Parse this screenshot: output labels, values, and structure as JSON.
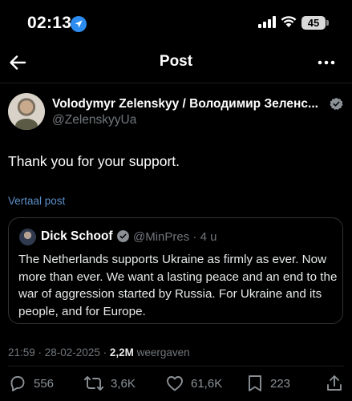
{
  "status_bar": {
    "time": "02:13",
    "battery": "45"
  },
  "header": {
    "title": "Post"
  },
  "post": {
    "author_name": "Volodymyr Zelenskyy / Володимир Зеленс...",
    "author_handle": "@ZelenskyyUa",
    "text": "Thank you for your support.",
    "translate_label": "Vertaal post"
  },
  "quote": {
    "name": "Dick Schoof",
    "handle_time": "@MinPres · 4 u",
    "text": "The Netherlands supports Ukraine as firmly as ever. Now more than ever. We want a lasting peace and an end to the war of aggression started by Russia. For Ukraine and its people, and for Europe."
  },
  "meta": {
    "datetime": "21:59 · 28-02-2025 · ",
    "views": "2,2M",
    "views_label": " weergaven"
  },
  "actions": {
    "replies": "556",
    "reposts": "3,6K",
    "likes": "61,6K",
    "bookmarks": "223"
  },
  "colors": {
    "accent": "#1d9bf0",
    "muted": "#71767b",
    "link": "#5b8fc9"
  },
  "icons": [
    "location-arrow-icon",
    "signal-icon",
    "wifi-icon",
    "battery-icon",
    "back-arrow-icon",
    "more-icon",
    "verified-badge-icon",
    "reply-icon",
    "repost-icon",
    "like-icon",
    "bookmark-icon",
    "share-icon"
  ]
}
